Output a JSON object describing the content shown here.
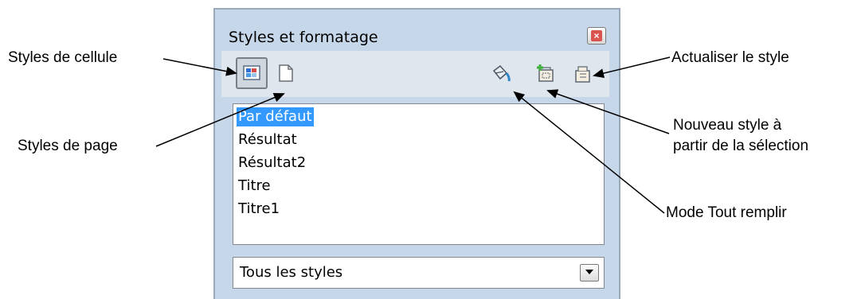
{
  "panel": {
    "title": "Styles et formatage",
    "close_icon": "close-icon",
    "toolbar": {
      "cell_styles_icon": "cell-styles-icon",
      "page_styles_icon": "page-styles-icon",
      "fill_format_icon": "paint-bucket-icon",
      "new_style_icon": "new-style-icon",
      "update_style_icon": "update-style-icon"
    },
    "styles_list": [
      "Par défaut",
      "Résultat",
      "Résultat2",
      "Titre",
      "Titre1"
    ],
    "selected_style": "Par défaut",
    "filter": {
      "value": "Tous les styles"
    }
  },
  "callouts": {
    "cell_styles": "Styles de cellule",
    "page_styles": "Styles de page",
    "update_style": "Actualiser le style",
    "new_style_line1": "Nouveau style à",
    "new_style_line2": "partir de la sélection",
    "fill_mode": "Mode Tout remplir"
  },
  "colors": {
    "panel_background": "#c7d7ea",
    "selection": "#3399ff",
    "toolbar_background": "#dfe6ee"
  }
}
